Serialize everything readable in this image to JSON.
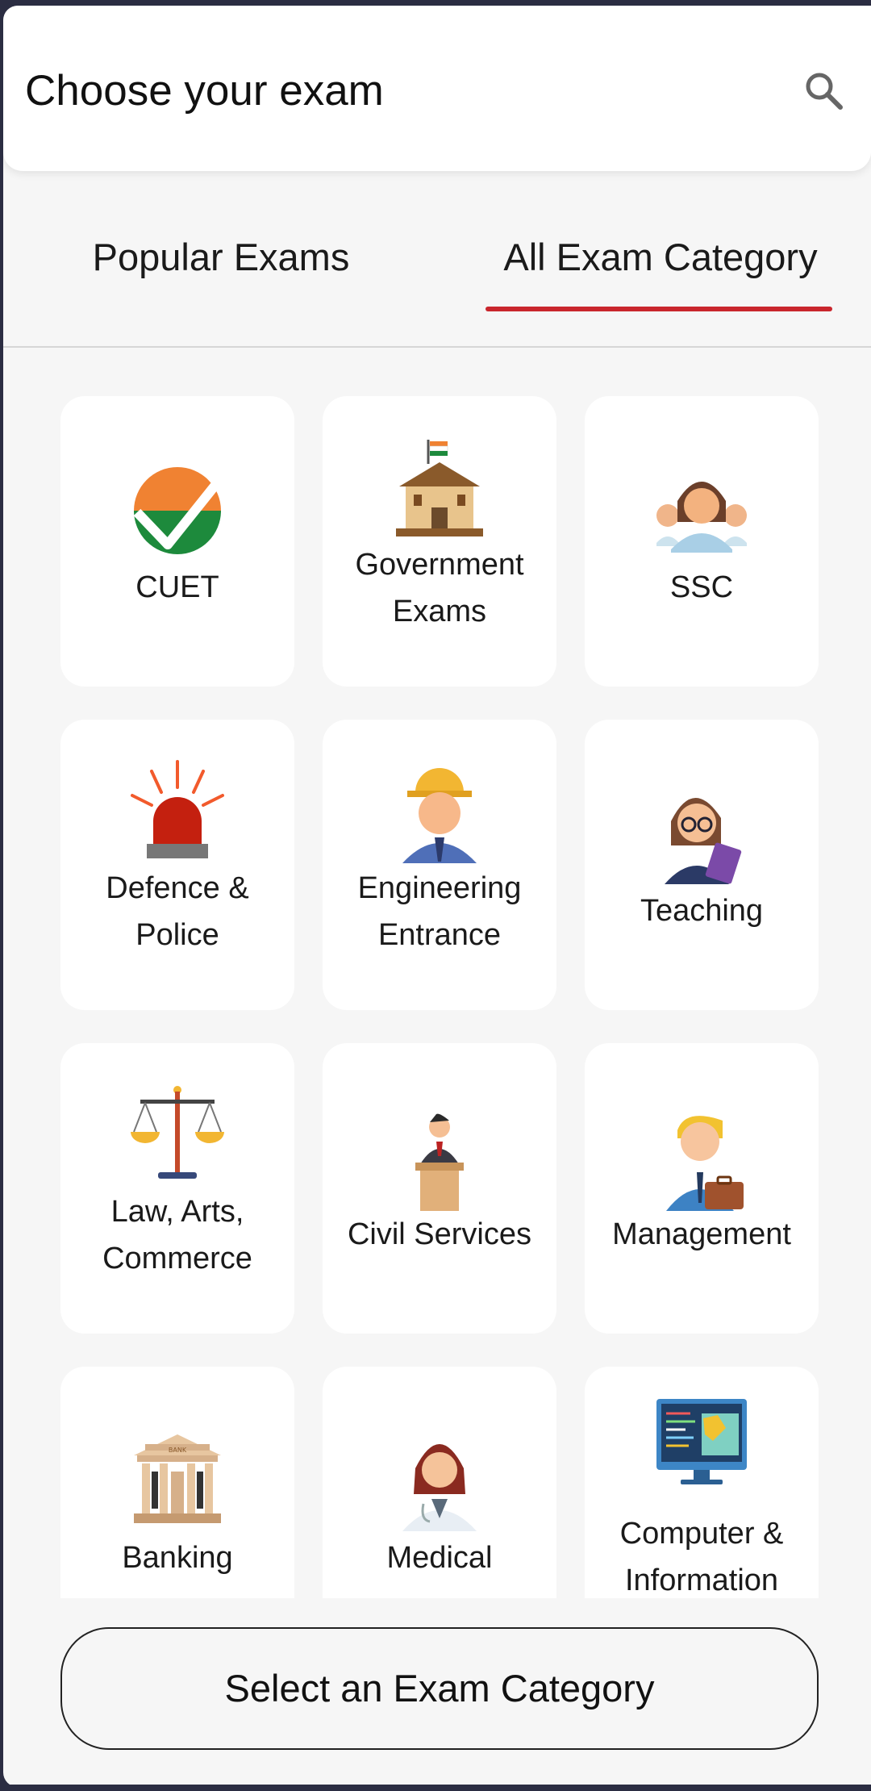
{
  "header": {
    "title": "Choose your exam",
    "search_icon": "search-icon"
  },
  "tabs": [
    {
      "label": "Popular Exams",
      "active": false
    },
    {
      "label": "All Exam Category",
      "active": true
    }
  ],
  "accent_color": "#c9262d",
  "categories": [
    {
      "line1": "CUET",
      "line2": "",
      "icon": "cuet-check-icon"
    },
    {
      "line1": "Government",
      "line2": "Exams",
      "icon": "government-building-icon"
    },
    {
      "line1": "SSC",
      "line2": "",
      "icon": "people-group-icon"
    },
    {
      "line1": "Defence &",
      "line2": "Police",
      "icon": "siren-icon"
    },
    {
      "line1": "Engineering",
      "line2": "Entrance",
      "icon": "engineer-icon"
    },
    {
      "line1": "Teaching",
      "line2": "",
      "icon": "teacher-icon"
    },
    {
      "line1": "Law, Arts,",
      "line2": "Commerce",
      "icon": "scales-icon"
    },
    {
      "line1": "Civil Services",
      "line2": "",
      "icon": "speaker-podium-icon"
    },
    {
      "line1": "Management",
      "line2": "",
      "icon": "manager-briefcase-icon"
    },
    {
      "line1": "Banking",
      "line2": "",
      "icon": "bank-icon"
    },
    {
      "line1": "Medical",
      "line2": "",
      "icon": "doctor-icon"
    },
    {
      "line1": "Computer &",
      "line2": "Information",
      "icon": "computer-monitor-icon"
    }
  ],
  "footer": {
    "button_label": "Select an Exam Category"
  }
}
